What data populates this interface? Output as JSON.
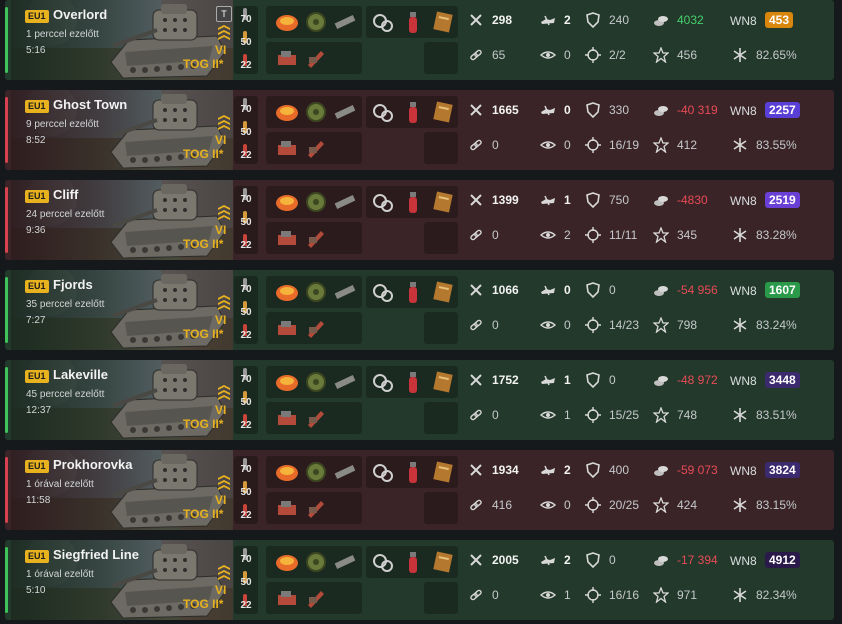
{
  "battles": [
    {
      "result": "win",
      "region": "EU1",
      "map": "Overlord",
      "time_ago": "1 perccel ezelőtt",
      "duration": "5:16",
      "tier": "VI",
      "tank": "TOG II*",
      "has_badge": true,
      "shells": [
        "70",
        "50",
        "22"
      ],
      "damage": "298",
      "kills": "2",
      "blocked": "240",
      "credits": "4032",
      "credits_sign": "pos",
      "assist": "65",
      "spotted": "0",
      "hits": "2/2",
      "xp": "456",
      "wn8": "453",
      "wn8_color": "#d9860c",
      "accuracy": "82.65%"
    },
    {
      "result": "loss",
      "region": "EU1",
      "map": "Ghost Town",
      "time_ago": "9 perccel ezelőtt",
      "duration": "8:52",
      "tier": "VI",
      "tank": "TOG II*",
      "has_badge": false,
      "shells": [
        "70",
        "50",
        "22"
      ],
      "damage": "1665",
      "kills": "0",
      "blocked": "330",
      "credits": "-40 319",
      "credits_sign": "neg",
      "assist": "0",
      "spotted": "0",
      "hits": "16/19",
      "xp": "412",
      "wn8": "2257",
      "wn8_color": "#5a3fd6",
      "accuracy": "83.55%"
    },
    {
      "result": "loss",
      "region": "EU1",
      "map": "Cliff",
      "time_ago": "24 perccel ezelőtt",
      "duration": "9:36",
      "tier": "VI",
      "tank": "TOG II*",
      "has_badge": false,
      "shells": [
        "70",
        "50",
        "22"
      ],
      "damage": "1399",
      "kills": "1",
      "blocked": "750",
      "credits": "-4830",
      "credits_sign": "neg",
      "assist": "0",
      "spotted": "2",
      "hits": "11/11",
      "xp": "345",
      "wn8": "2519",
      "wn8_color": "#6a3fd6",
      "accuracy": "83.28%"
    },
    {
      "result": "win",
      "region": "EU1",
      "map": "Fjords",
      "time_ago": "35 perccel ezelőtt",
      "duration": "7:27",
      "tier": "VI",
      "tank": "TOG II*",
      "has_badge": false,
      "shells": [
        "70",
        "50",
        "22"
      ],
      "damage": "1066",
      "kills": "0",
      "blocked": "0",
      "credits": "-54 956",
      "credits_sign": "neg",
      "assist": "0",
      "spotted": "0",
      "hits": "14/23",
      "xp": "798",
      "wn8": "1607",
      "wn8_color": "#2a9a4a",
      "accuracy": "83.24%"
    },
    {
      "result": "win",
      "region": "EU1",
      "map": "Lakeville",
      "time_ago": "45 perccel ezelőtt",
      "duration": "12:37",
      "tier": "VI",
      "tank": "TOG II*",
      "has_badge": false,
      "shells": [
        "70",
        "50",
        "22"
      ],
      "damage": "1752",
      "kills": "1",
      "blocked": "0",
      "credits": "-48 972",
      "credits_sign": "neg",
      "assist": "0",
      "spotted": "1",
      "hits": "15/25",
      "xp": "748",
      "wn8": "3448",
      "wn8_color": "#3b2a6e",
      "accuracy": "83.51%"
    },
    {
      "result": "loss",
      "region": "EU1",
      "map": "Prokhorovka",
      "time_ago": "1 órával ezelőtt",
      "duration": "11:58",
      "tier": "VI",
      "tank": "TOG II*",
      "has_badge": false,
      "shells": [
        "70",
        "50",
        "22"
      ],
      "damage": "1934",
      "kills": "2",
      "blocked": "400",
      "credits": "-59 073",
      "credits_sign": "neg",
      "assist": "416",
      "spotted": "0",
      "hits": "20/25",
      "xp": "424",
      "wn8": "3824",
      "wn8_color": "#3b2a6e",
      "accuracy": "83.15%"
    },
    {
      "result": "win",
      "region": "EU1",
      "map": "Siegfried Line",
      "time_ago": "1 órával ezelőtt",
      "duration": "5:10",
      "tier": "VI",
      "tank": "TOG II*",
      "has_badge": false,
      "shells": [
        "70",
        "50",
        "22"
      ],
      "damage": "2005",
      "kills": "2",
      "blocked": "0",
      "credits": "-17 394",
      "credits_sign": "neg",
      "assist": "0",
      "spotted": "1",
      "hits": "16/16",
      "xp": "971",
      "wn8": "4912",
      "wn8_color": "#2a1a4a",
      "accuracy": "82.34%"
    }
  ],
  "labels": {
    "wn8": "WN8",
    "badge_letter": "T"
  },
  "icons": {
    "damage": "crossed-swords-icon",
    "kills": "destroyed-tank-icon",
    "blocked": "shield-icon",
    "credits": "credits-icon",
    "assist": "assist-link-icon",
    "spotted": "eye-icon",
    "hits": "crosshair-icon",
    "xp": "star-icon",
    "accuracy": "snowflake-icon"
  }
}
